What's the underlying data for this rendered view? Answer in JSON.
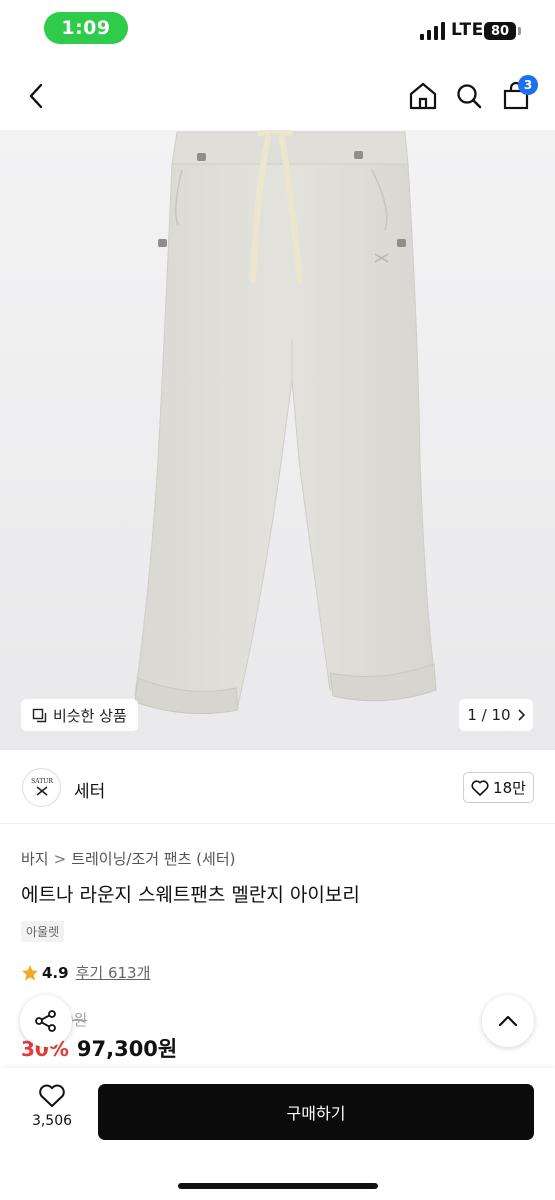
{
  "status_bar": {
    "time": "1:09",
    "network": "LTE",
    "battery": "80"
  },
  "header": {
    "cart_count": "3"
  },
  "gallery": {
    "similar_label": "비슷한 상품",
    "page": "1 / 10"
  },
  "brand": {
    "name": "세터",
    "logo_text": "SATUR",
    "likes": "18만"
  },
  "product": {
    "breadcrumb": [
      "바지",
      "트레이닝/조거 팬츠 (세터)"
    ],
    "title": "에트나 라운지 스웨트팬츠 멜란지 아이보리",
    "tag": "아울렛",
    "rating": "4.9",
    "review_label": "후기 613개",
    "original_price": "0원",
    "discount": "30%",
    "price": "97,300원"
  },
  "bottom": {
    "wish_count": "3,506",
    "buy_label": "구매하기"
  },
  "colors": {
    "accent_blue": "#1c6ff0",
    "discount_red": "#e53a3a",
    "star": "#f5a623",
    "status_green": "#2ecc4a"
  }
}
